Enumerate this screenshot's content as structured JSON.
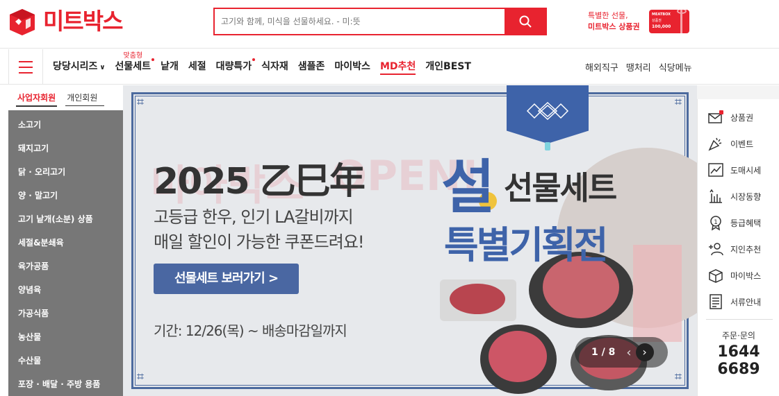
{
  "header": {
    "logo_text": "미트박스",
    "search_placeholder": "고기와 함께, 미식을 선물하세요. - 미:뜻",
    "promo_line1": "특별한 선물,",
    "promo_line2": "미트박스 상품권",
    "giftcard_brand": "MEATBOX",
    "giftcard_sub": "상품권",
    "giftcard_amount": "100,000",
    "accent_color": "#e8232f"
  },
  "nav": {
    "items": [
      {
        "label": "당당시리즈",
        "chevron": true
      },
      {
        "label": "선물세트",
        "tag": "맞춤형",
        "dot": true
      },
      {
        "label": "낱개"
      },
      {
        "label": "세절"
      },
      {
        "label": "대량특가",
        "dot": true
      },
      {
        "label": "식자재"
      },
      {
        "label": "샘플존"
      },
      {
        "label": "마이박스"
      },
      {
        "label": "MD추천",
        "highlight": true
      },
      {
        "label": "개인BEST"
      }
    ],
    "right_links": [
      "해외직구",
      "땡처리",
      "식당메뉴"
    ]
  },
  "sidebar": {
    "tabs": [
      {
        "label": "사업자회원",
        "active": true
      },
      {
        "label": "개인회원",
        "active": false
      }
    ],
    "categories": [
      "소고기",
      "돼지고기",
      "닭 · 오리고기",
      "양 · 말고기",
      "고기 낱개(소분) 상품",
      "세절&분쇄육",
      "육가공품",
      "양념육",
      "가공식품",
      "농산물",
      "수산물",
      "포장 · 배달 · 주방 용품"
    ]
  },
  "banner": {
    "year": "2025 乙巳年",
    "desc_line1": "고등급 한우, 인기 LA갈비까지",
    "desc_line2": "매일 할인이 가능한 쿠폰드려요!",
    "cta_label": "선물세트 보러가기 >",
    "period": "기간: 12/26(목) ~ 배송마감일까지",
    "seol": "설",
    "giftset": "선물세트",
    "special": "특별기획전",
    "pager_text": "1 / 8",
    "primary_color": "#3e63a9"
  },
  "quick_menu": {
    "items": [
      {
        "label": "상품권",
        "icon": "gift-voucher-icon"
      },
      {
        "label": "이벤트",
        "icon": "party-popper-icon"
      },
      {
        "label": "도매시세",
        "icon": "trend-chart-icon"
      },
      {
        "label": "시장동향",
        "icon": "bar-chart-icon"
      },
      {
        "label": "등급혜택",
        "icon": "medal-icon"
      },
      {
        "label": "지인추천",
        "icon": "user-plus-icon"
      },
      {
        "label": "마이박스",
        "icon": "box-icon"
      },
      {
        "label": "서류안내",
        "icon": "document-icon"
      }
    ],
    "cs_label": "주문·문의",
    "cs_number_line1": "1644",
    "cs_number_line2": "6689"
  }
}
